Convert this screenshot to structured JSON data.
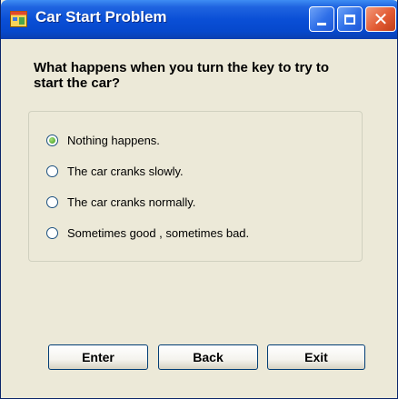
{
  "window": {
    "title": "Car Start Problem"
  },
  "question": "What happens when you turn the key to try to start the car?",
  "options": [
    {
      "label": "Nothing happens.",
      "selected": true
    },
    {
      "label": "The car cranks slowly.",
      "selected": false
    },
    {
      "label": "The car cranks normally.",
      "selected": false
    },
    {
      "label": "Sometimes good , sometimes bad.",
      "selected": false
    }
  ],
  "buttons": {
    "enter": "Enter",
    "back": "Back",
    "exit": "Exit"
  },
  "colors": {
    "titlebar": "#0A4FD6",
    "close_button": "#E25B34",
    "window_bg": "#ECE9D8"
  }
}
